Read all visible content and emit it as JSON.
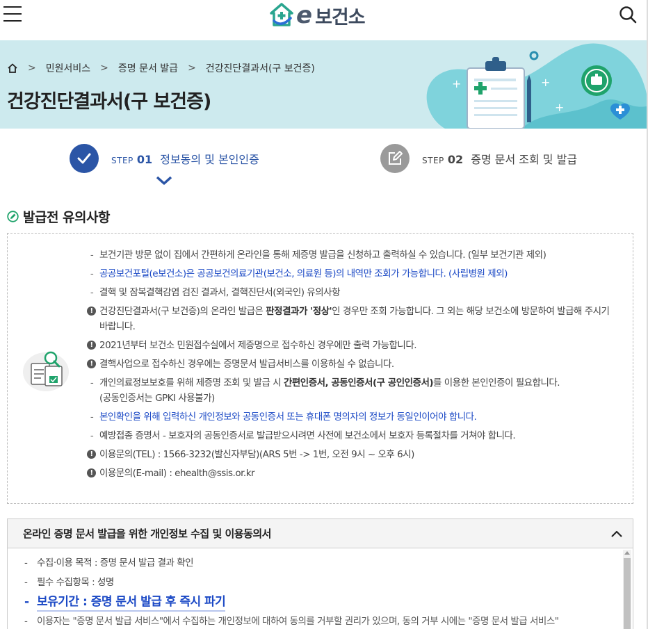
{
  "header": {
    "logo_e": "e",
    "logo_text": "보건소"
  },
  "breadcrumb": {
    "items": [
      "민원서비스",
      "증명 문서 발급",
      "건강진단결과서(구 보건증)"
    ]
  },
  "page_title": "건강진단결과서(구 보건증)",
  "steps": [
    {
      "pre": "STEP",
      "num": "01",
      "label": "정보동의 및 본인인증"
    },
    {
      "pre": "STEP",
      "num": "02",
      "label": "증명 문서 조회 및 발급"
    }
  ],
  "notice": {
    "title": "발급전 유의사항",
    "items": [
      {
        "type": "dash",
        "text": "보건기관 방문 없이 집에서 간편하게 온라인을 통해 제증명 발급을 신청하고 출력하실 수 있습니다. (일부 보건기관 제외)"
      },
      {
        "type": "dash-blue",
        "text": "공공보건포털(e보건소)은 공공보건의료기관(보건소, 의료원 등)의 내역만 조회가 가능합니다. (사립병원 제외)"
      },
      {
        "type": "dash",
        "text": "결핵 및 잠복결핵감염 검진 결과서, 결핵진단서(외국인) 유의사항"
      },
      {
        "type": "excl",
        "text_a": "건강진단결과서(구 보건증)의 온라인 발급은 ",
        "bold": "판정결과가 '정상'",
        "text_b": "인 경우만 조회 가능합니다. 그 외는 해당 보건소에 방문하여 발급해 주시기 바랍니다."
      },
      {
        "type": "excl",
        "text": "2021년부터 보건소 민원접수실에서 제증명으로 접수하신 경우에만 출력 가능합니다."
      },
      {
        "type": "excl",
        "text": "결핵사업으로 접수하신 경우에는 증명문서 발급서비스를 이용하실 수 없습니다."
      },
      {
        "type": "dash",
        "text_a": "개인의료정보보호를 위해 제증명 조회 및 발급 시 ",
        "bold": "간편인증서, 공동인증서(구 공인인증서)",
        "text_b": "를 이용한 본인인증이 필요합니다.",
        "sub": "(공동인증서는 GPKI 사용불가)"
      },
      {
        "type": "dash-blue",
        "text": "본인확인을 위해 입력하신 개인정보와 공동인증서 또는 휴대폰 명의자의 정보가 동일인이어야 합니다."
      },
      {
        "type": "dash",
        "text": "예방접종 증명서 - 보호자의 공동인증서로 발급받으시려면 사전에 보건소에서 보호자 등록절차를 거쳐야 합니다."
      },
      {
        "type": "excl",
        "text": "이용문의(TEL) : 1566-3232(발신자부담)(ARS 5번 -> 1번, 오전 9시 ~ 오후 6시)"
      },
      {
        "type": "excl",
        "text": "이용문의(E-mail) : ehealth@ssis.or.kr"
      }
    ],
    "excl_mark": "!",
    "dash_mark": "-"
  },
  "consent": {
    "title": "온라인 증명 문서 발급을 위한 개인정보 수집 및 이용동의서",
    "items": [
      {
        "text": "수집·이용 목적 : 증명 문서 발급 결과 확인"
      },
      {
        "text": "필수 수집항목 : 성명"
      },
      {
        "text": "보유기간 : 증명 문서 발급 후 즉시 파기"
      },
      {
        "text": "이용자는 \"증명 문서 발급 서비스\"에서 수집하는 개인정보에 대하여 동의를 거부할 권리가 있으며, 동의 거부 시에는 \"증명 문서 발급 서비스\""
      }
    ]
  },
  "colors": {
    "banner_bg": "#cdeaee",
    "step_active": "#2b55a6",
    "step_inactive": "#9a9a9a",
    "link_blue": "#1a48c5",
    "logo_green": "#2aa58f"
  },
  "icons": [
    "menu-icon",
    "search-icon",
    "home-icon",
    "check-icon",
    "edit-icon",
    "chevron-up-icon",
    "pencil-circle-icon",
    "exclamation-icon"
  ]
}
